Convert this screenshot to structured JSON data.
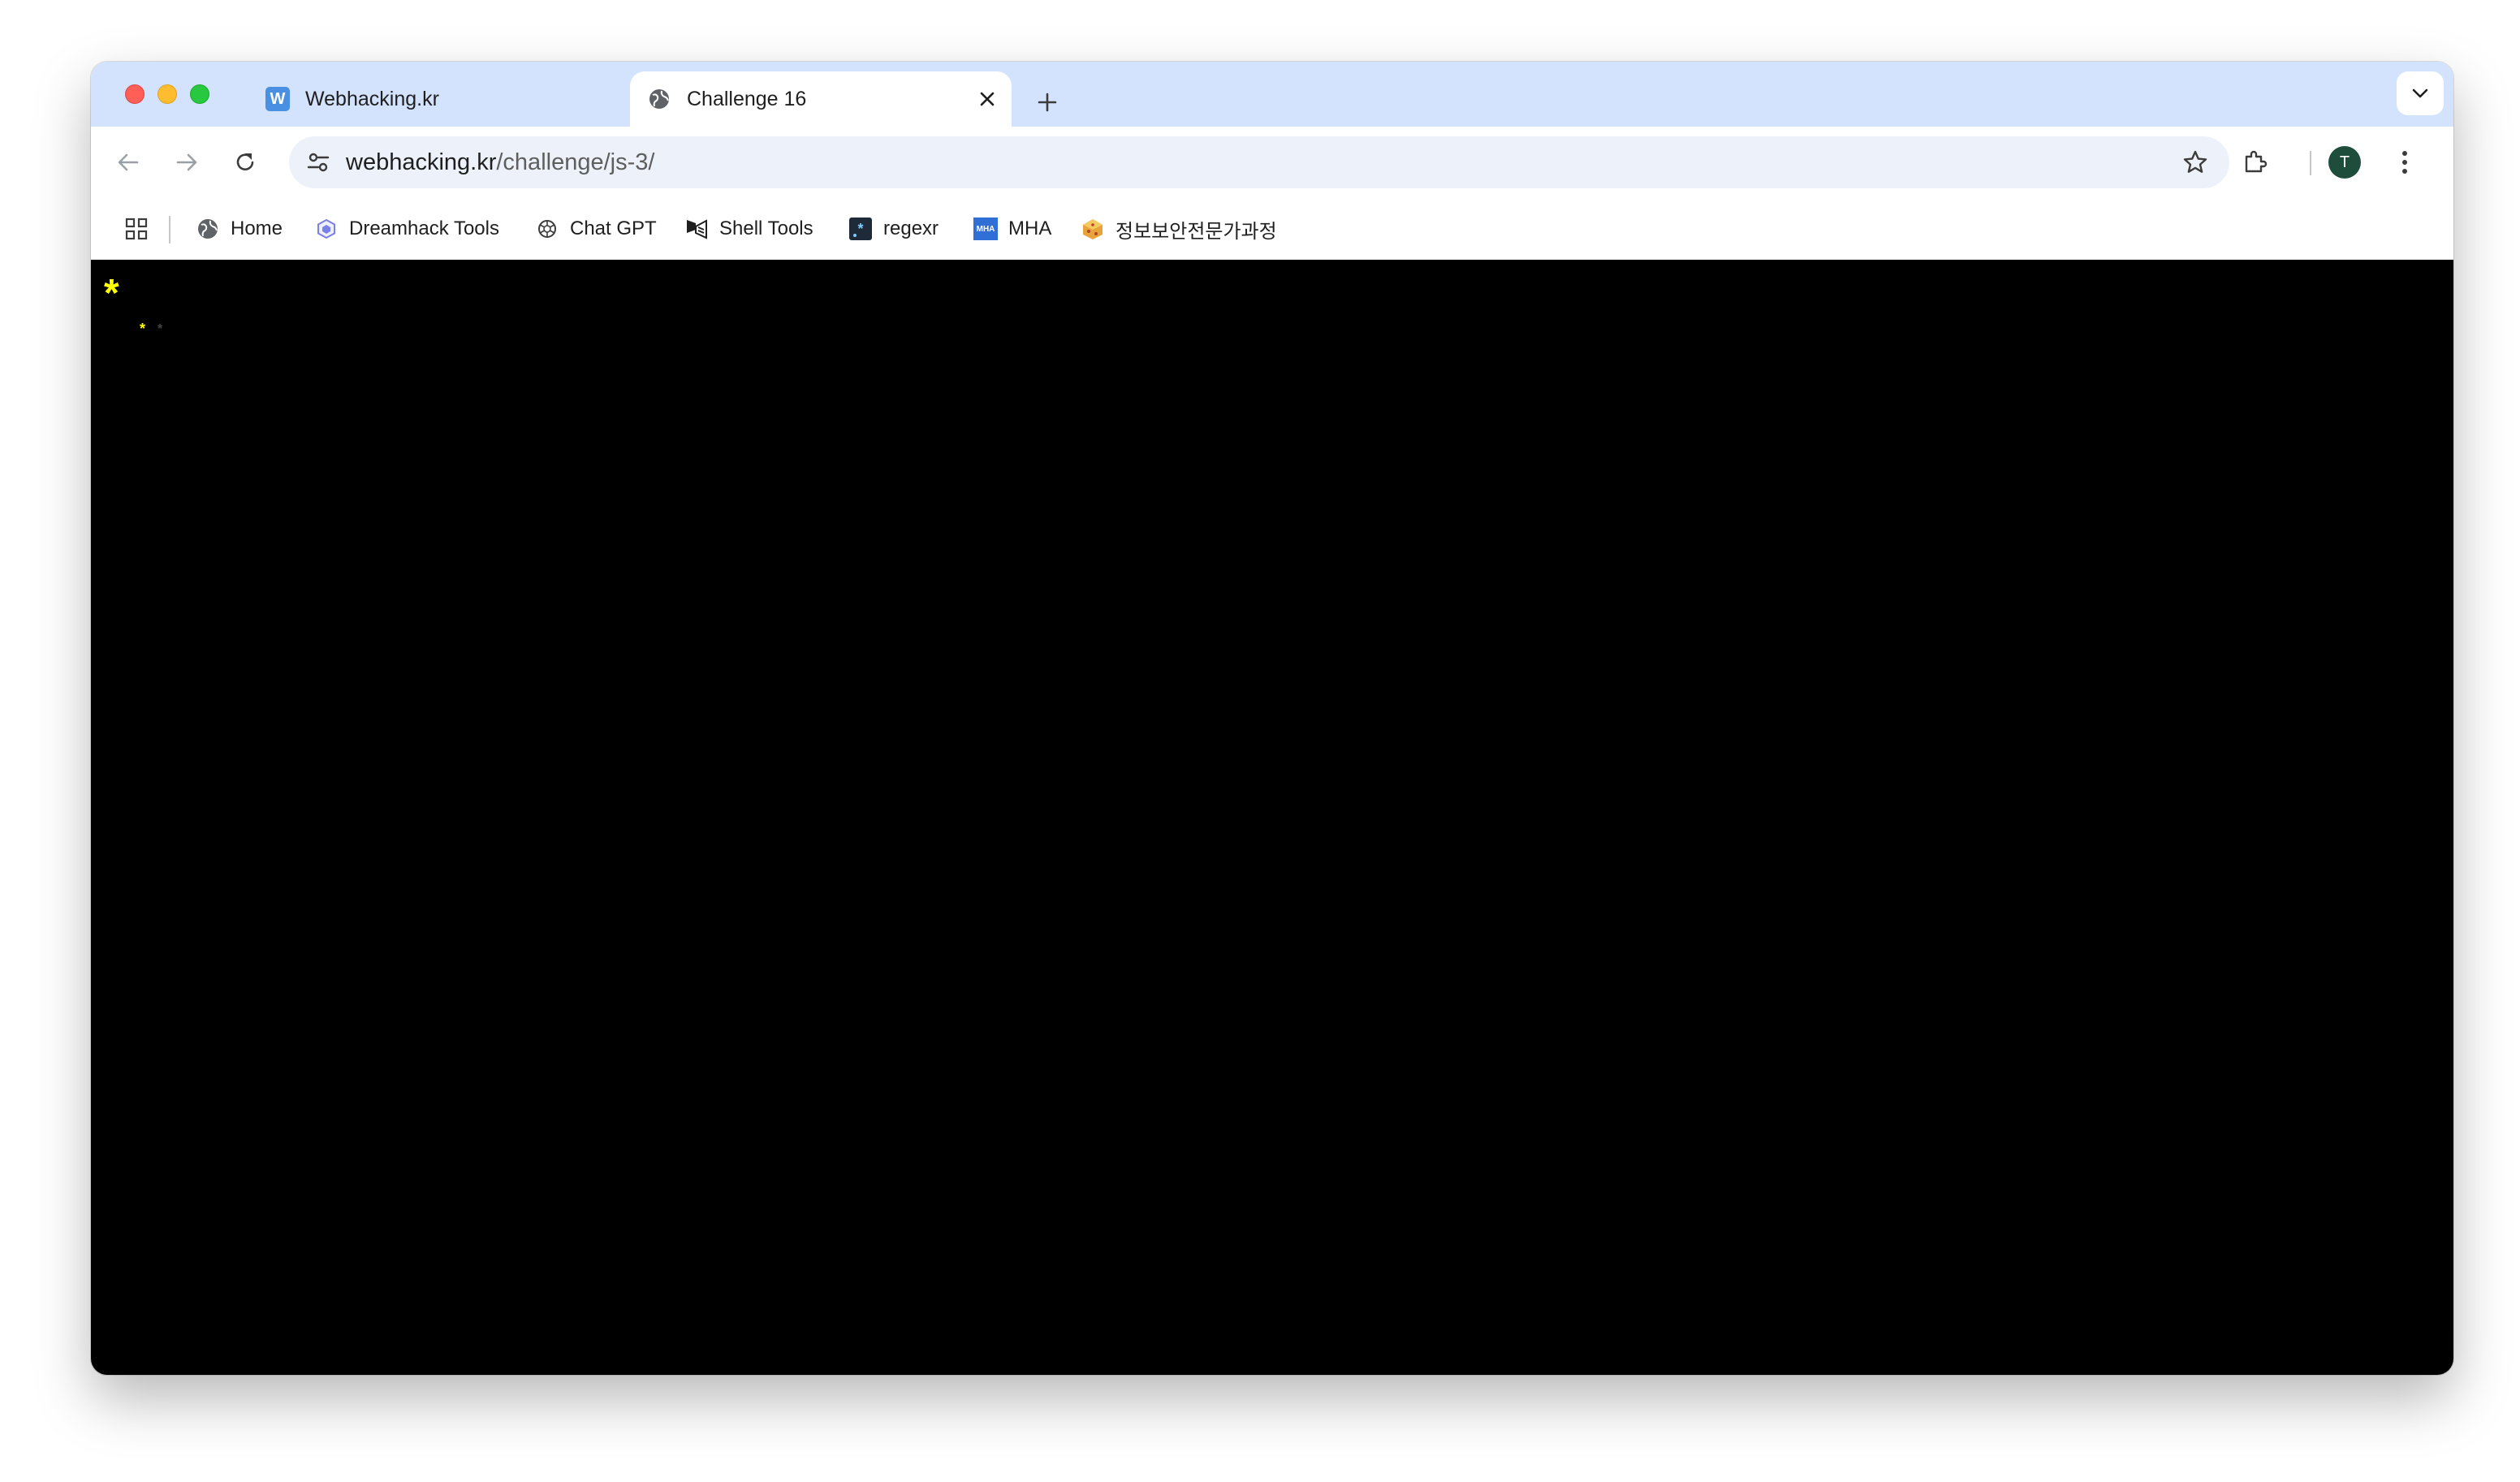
{
  "browser": {
    "tabs": [
      {
        "title": "Webhacking.kr",
        "favicon_letter": "W",
        "active": false
      },
      {
        "title": "Challenge 16",
        "active": true
      }
    ],
    "address": {
      "host": "webhacking.kr",
      "path": "/challenge/js-3/"
    },
    "avatar_letter": "T",
    "bookmarks": [
      {
        "label": "Home",
        "icon": "globe-icon"
      },
      {
        "label": "Dreamhack Tools",
        "icon": "dreamhack-icon"
      },
      {
        "label": "Chat GPT",
        "icon": "openai-icon"
      },
      {
        "label": "Shell Tools",
        "icon": "shell-icon"
      },
      {
        "label": "regexr",
        "icon": "regexr-icon"
      },
      {
        "label": "MHA",
        "icon": "mha-icon",
        "icon_text": "MHA"
      },
      {
        "label": "정보보안전문가과정",
        "icon": "cookie-icon"
      }
    ]
  },
  "page": {
    "big_star": "*",
    "small_star": "*",
    "dim_star": "*",
    "star_color": "#ffff00",
    "background": "#000000"
  }
}
